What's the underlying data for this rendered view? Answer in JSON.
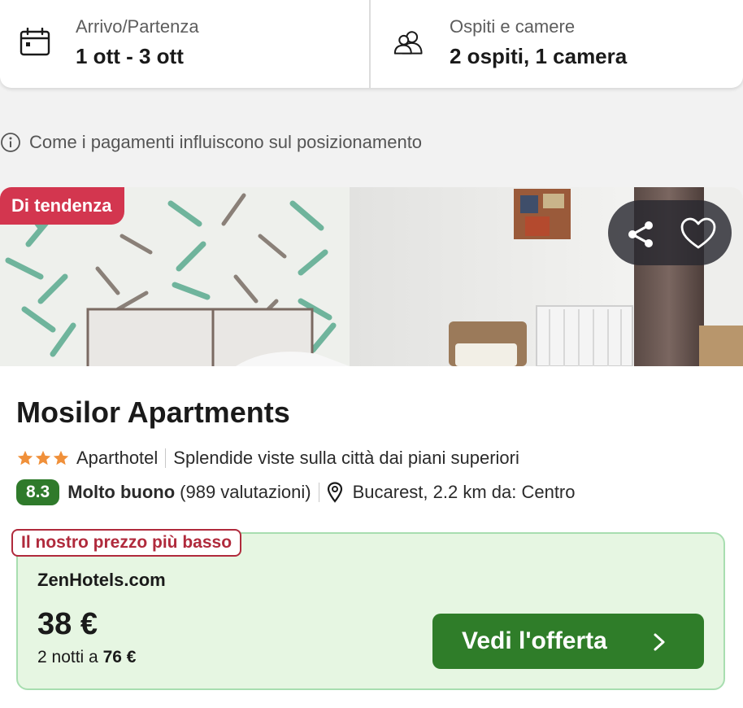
{
  "search": {
    "dates_label": "Arrivo/Partenza",
    "dates_value": "1 ott - 3 ott",
    "guests_label": "Ospiti e camere",
    "guests_value": "2 ospiti, 1 camera"
  },
  "ranking_info": "Come i pagamenti influiscono sul posizionamento",
  "hotel": {
    "badge": "Di tendenza",
    "name": "Mosilor Apartments",
    "stars": 3,
    "type": "Aparthotel",
    "highlight": "Splendide viste sulla città dai piani superiori",
    "score": "8.3",
    "rating_word": "Molto buono",
    "reviews": "(989 valutazioni)",
    "location": "Bucarest, 2.2 km da: Centro"
  },
  "offer": {
    "tag": "Il nostro prezzo più basso",
    "provider": "ZenHotels.com",
    "price": "38 €",
    "nights_prefix": "2 notti a",
    "total": "76 €",
    "cta": "Vedi l'offerta"
  },
  "colors": {
    "trend_badge": "#d3364f",
    "score_badge": "#2f7a2b",
    "cta": "#2f7d29",
    "offer_bg": "#e6f6e2",
    "tag_red": "#b02a3c",
    "stars": "#f0903a"
  },
  "icons": [
    "calendar-icon",
    "guests-icon",
    "info-icon",
    "share-icon",
    "heart-icon",
    "star-icon",
    "location-pin-icon",
    "chevron-right-icon"
  ]
}
